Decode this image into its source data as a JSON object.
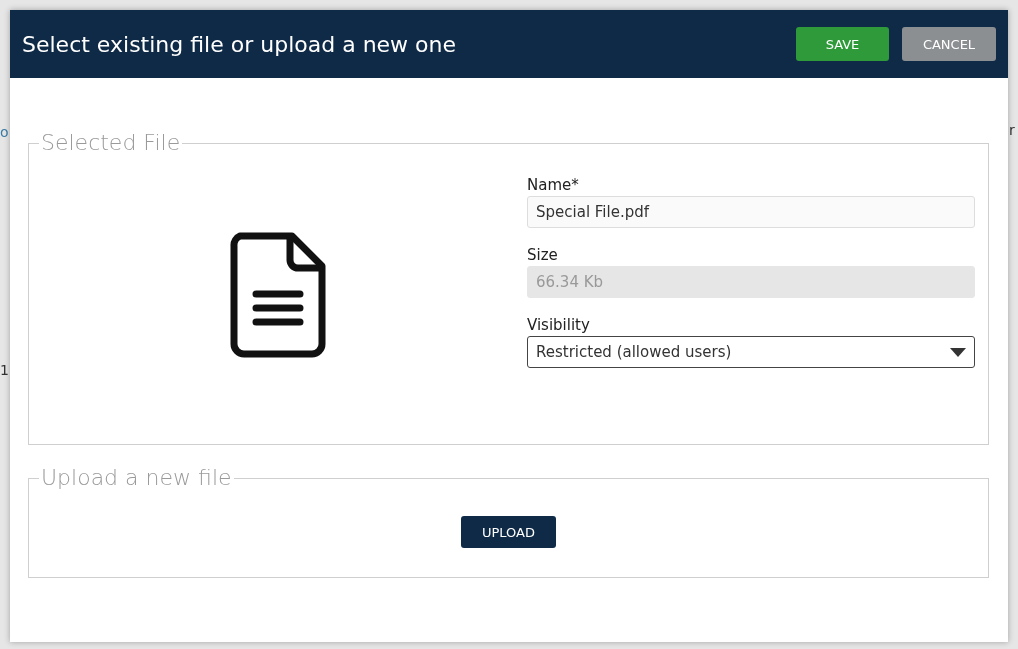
{
  "backdrop": {
    "texts": [
      {
        "text": "o",
        "kind": "link"
      },
      {
        "text": "1",
        "kind": "plain"
      },
      {
        "text": "r",
        "kind": "plain"
      }
    ]
  },
  "dialog": {
    "title": "Select existing file or upload a new one",
    "buttons": [
      {
        "label": "SAVE",
        "kind": "primary"
      },
      {
        "label": "CANCEL",
        "kind": "secondary"
      }
    ],
    "selected_file": {
      "legend": "Selected File",
      "fields": [
        {
          "label": "Name*",
          "value": "Special File.pdf",
          "kind": "text",
          "disabled": false
        },
        {
          "label": "Size",
          "value": "66.34 Kb",
          "kind": "text",
          "disabled": true
        },
        {
          "label": "Visibility",
          "value": "Restricted (allowed users)",
          "kind": "select",
          "disabled": false
        }
      ]
    },
    "upload": {
      "legend": "Upload a new file",
      "button": "UPLOAD"
    }
  }
}
